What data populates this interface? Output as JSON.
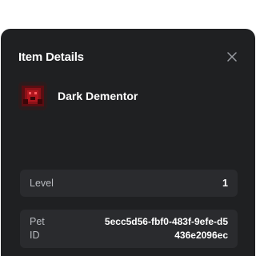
{
  "modal": {
    "title": "Item Details",
    "close_icon": "close-icon"
  },
  "pet": {
    "name": "Dark Dementor",
    "thumbnail_icon": "dementor-thumbnail"
  },
  "details": {
    "level_label": "Level",
    "level_value": "1",
    "petid_label": "Pet ID",
    "petid_value": "5ecc5d56-fbf0-483f-9efe-d5436e2096ec"
  },
  "colors": {
    "modal_bg": "#1f2022",
    "card_bg": "#2a2b2e",
    "label_text": "#b9bcc1",
    "text": "#ffffff"
  }
}
